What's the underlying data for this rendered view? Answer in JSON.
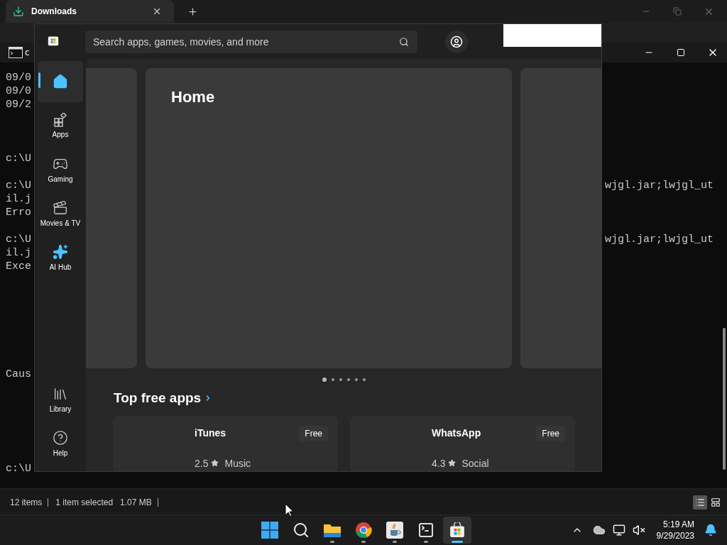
{
  "explorer": {
    "tab_title": "Downloads",
    "status": {
      "count": "12 items",
      "selection": "1 item selected",
      "size": "1.07 MB"
    },
    "views": [
      {
        "kind": "details",
        "selected": true
      },
      {
        "kind": "tiles",
        "selected": false
      }
    ]
  },
  "terminal": {
    "title": "c",
    "left_lines": [
      "09/0",
      "09/0",
      "09/2",
      "c:\\U",
      "c:\\U",
      "il.j",
      "Erro",
      "c:\\U",
      "il.j",
      "Exce",
      "Caus",
      "c:\\U"
    ],
    "right_lines": [
      "wjgl.jar;lwjgl_ut",
      "wjgl.jar;lwjgl_ut"
    ]
  },
  "store": {
    "search": {
      "placeholder": "Search apps, games, movies, and more"
    },
    "nav": [
      {
        "kind": "home",
        "selected": true
      },
      {
        "kind": "apps",
        "label": "Apps",
        "selected": false
      },
      {
        "kind": "gaming",
        "label": "Gaming",
        "selected": false
      },
      {
        "kind": "movies",
        "label": "Movies & TV",
        "selected": false
      },
      {
        "kind": "ai",
        "label": "AI Hub",
        "selected": false
      }
    ],
    "nav_bottom": [
      {
        "kind": "library",
        "label": "Library"
      },
      {
        "kind": "help",
        "label": "Help"
      }
    ],
    "hero": {
      "title": "Home",
      "dots": [
        {
          "selected": true
        },
        {
          "selected": false
        },
        {
          "selected": false
        },
        {
          "selected": false
        },
        {
          "selected": false
        },
        {
          "selected": false
        }
      ]
    },
    "section_title": "Top free apps",
    "apps": [
      {
        "name": "iTunes",
        "rating": "2.5",
        "category": "Music",
        "price": "Free"
      },
      {
        "name": "WhatsApp",
        "rating": "4.3",
        "category": "Social",
        "price": "Free"
      }
    ]
  },
  "taskbar": {
    "apps": [
      {
        "kind": "start",
        "running": false,
        "selected": false
      },
      {
        "kind": "search",
        "running": false,
        "selected": false
      },
      {
        "kind": "explorer",
        "running": true,
        "selected": false
      },
      {
        "kind": "chrome",
        "running": true,
        "selected": false
      },
      {
        "kind": "java",
        "running": true,
        "selected": false
      },
      {
        "kind": "terminal",
        "running": true,
        "selected": false
      },
      {
        "kind": "store",
        "running": true,
        "selected": true
      }
    ],
    "time": "5:19 AM",
    "date": "9/29/2023"
  }
}
